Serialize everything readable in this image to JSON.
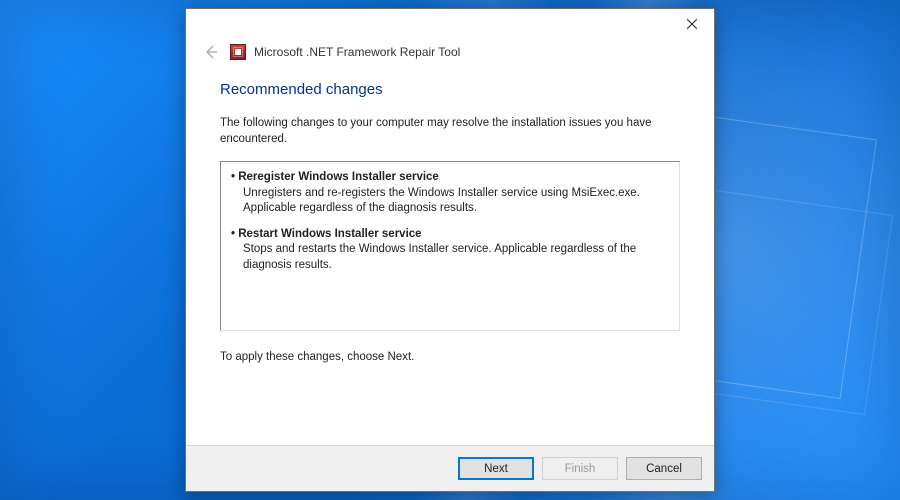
{
  "window": {
    "title": "Microsoft .NET Framework Repair Tool"
  },
  "page": {
    "heading": "Recommended changes",
    "intro": "The following changes to your computer may resolve the installation issues you have encountered.",
    "apply_note": "To apply these changes, choose Next."
  },
  "changes": [
    {
      "title": "Reregister Windows Installer service",
      "desc": "Unregisters and re-registers the Windows Installer service using MsiExec.exe. Applicable regardless of the diagnosis results."
    },
    {
      "title": "Restart Windows Installer service",
      "desc": "Stops and restarts the Windows Installer service. Applicable regardless of the diagnosis results."
    }
  ],
  "buttons": {
    "next": "Next",
    "finish": "Finish",
    "cancel": "Cancel"
  }
}
